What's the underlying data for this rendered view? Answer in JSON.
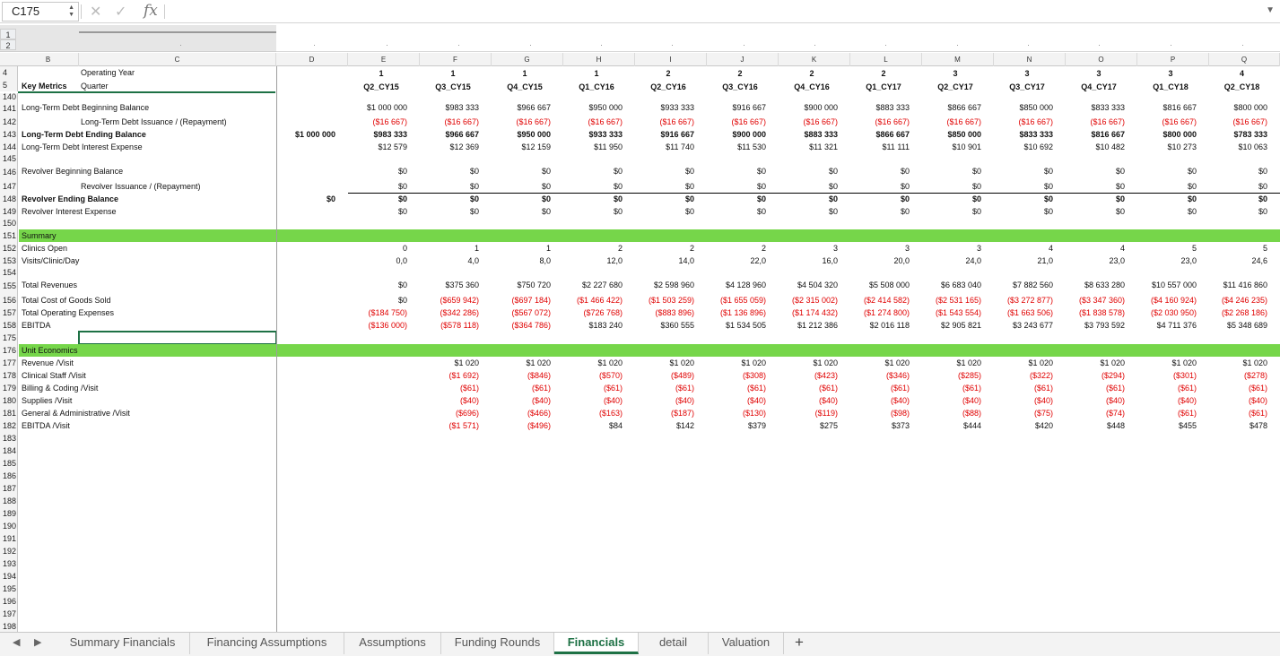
{
  "formula_bar": {
    "cell_ref": "C175",
    "formula": "",
    "cancel_icon": "✕",
    "confirm_icon": "✓",
    "fx_label": "fx"
  },
  "outline": {
    "levels": [
      "1",
      "2"
    ]
  },
  "columns": [
    "B",
    "C",
    "D",
    "E",
    "F",
    "G",
    "H",
    "I",
    "J",
    "K",
    "L",
    "M",
    "N",
    "O",
    "P",
    "Q"
  ],
  "header_rows": {
    "r4": {
      "num": "4",
      "label": "Operating Year",
      "values": [
        "1",
        "1",
        "1",
        "1",
        "2",
        "2",
        "2",
        "2",
        "3",
        "3",
        "3",
        "3",
        "4"
      ]
    },
    "r5": {
      "num": "5",
      "label_b": "Key Metrics",
      "label_c": "Quarter",
      "values": [
        "Q2_CY15",
        "Q3_CY15",
        "Q4_CY15",
        "Q1_CY16",
        "Q2_CY16",
        "Q3_CY16",
        "Q4_CY16",
        "Q1_CY17",
        "Q2_CY17",
        "Q3_CY17",
        "Q4_CY17",
        "Q1_CY18",
        "Q2_CY18"
      ]
    }
  },
  "rows": [
    {
      "num": "140"
    },
    {
      "num": "141",
      "label": "Long-Term Debt Beginning Balance",
      "d": "",
      "values": [
        "$1 000 000",
        "$983 333",
        "$966 667",
        "$950 000",
        "$933 333",
        "$916 667",
        "$900 000",
        "$883 333",
        "$866 667",
        "$850 000",
        "$833 333",
        "$816 667",
        "$800 000"
      ]
    },
    {
      "num": "142",
      "label": "Long-Term Debt Issuance / (Repayment)",
      "indent": true,
      "neg": true,
      "values": [
        "($16 667)",
        "($16 667)",
        "($16 667)",
        "($16 667)",
        "($16 667)",
        "($16 667)",
        "($16 667)",
        "($16 667)",
        "($16 667)",
        "($16 667)",
        "($16 667)",
        "($16 667)",
        "($16 667)"
      ]
    },
    {
      "num": "143",
      "label": "Long-Term Debt Ending Balance",
      "bold": true,
      "d": "$1 000 000",
      "values": [
        "$983 333",
        "$966 667",
        "$950 000",
        "$933 333",
        "$916 667",
        "$900 000",
        "$883 333",
        "$866 667",
        "$850 000",
        "$833 333",
        "$816 667",
        "$800 000",
        "$783 333"
      ]
    },
    {
      "num": "144",
      "label": "Long-Term Debt Interest Expense",
      "values": [
        "$12 579",
        "$12 369",
        "$12 159",
        "$11 950",
        "$11 740",
        "$11 530",
        "$11 321",
        "$11 111",
        "$10 901",
        "$10 692",
        "$10 482",
        "$10 273",
        "$10 063"
      ]
    },
    {
      "num": "145"
    },
    {
      "num": "146",
      "label": "Revolver Beginning Balance",
      "values": [
        "$0",
        "$0",
        "$0",
        "$0",
        "$0",
        "$0",
        "$0",
        "$0",
        "$0",
        "$0",
        "$0",
        "$0",
        "$0"
      ]
    },
    {
      "num": "147",
      "label": "Revolver Issuance / (Repayment)",
      "indent": true,
      "values": [
        "$0",
        "$0",
        "$0",
        "$0",
        "$0",
        "$0",
        "$0",
        "$0",
        "$0",
        "$0",
        "$0",
        "$0",
        "$0"
      ]
    },
    {
      "num": "148",
      "label": "Revolver Ending Balance",
      "bold": true,
      "d": "$0",
      "values": [
        "$0",
        "$0",
        "$0",
        "$0",
        "$0",
        "$0",
        "$0",
        "$0",
        "$0",
        "$0",
        "$0",
        "$0",
        "$0"
      ]
    },
    {
      "num": "149",
      "label": "Revolver Interest Expense",
      "values": [
        "$0",
        "$0",
        "$0",
        "$0",
        "$0",
        "$0",
        "$0",
        "$0",
        "$0",
        "$0",
        "$0",
        "$0",
        "$0"
      ]
    },
    {
      "num": "150"
    },
    {
      "num": "151",
      "label": "Summary",
      "green": true
    },
    {
      "num": "152",
      "label": "Clinics Open",
      "values": [
        "0",
        "1",
        "1",
        "2",
        "2",
        "2",
        "3",
        "3",
        "3",
        "4",
        "4",
        "5",
        "5"
      ]
    },
    {
      "num": "153",
      "label": "Visits/Clinic/Day",
      "values": [
        "0,0",
        "4,0",
        "8,0",
        "12,0",
        "14,0",
        "22,0",
        "16,0",
        "20,0",
        "24,0",
        "21,0",
        "23,0",
        "23,0",
        "24,6"
      ]
    },
    {
      "num": "154"
    },
    {
      "num": "155",
      "label": "Total Revenues",
      "values": [
        "$0",
        "$375 360",
        "$750 720",
        "$2 227 680",
        "$2 598 960",
        "$4 128 960",
        "$4 504 320",
        "$5 508 000",
        "$6 683 040",
        "$7 882 560",
        "$8 633 280",
        "$10 557 000",
        "$11 416 860"
      ]
    },
    {
      "num": "156",
      "label": "Total Cost of Goods Sold",
      "neg_from": 1,
      "values": [
        "$0",
        "($659 942)",
        "($697 184)",
        "($1 466 422)",
        "($1 503 259)",
        "($1 655 059)",
        "($2 315 002)",
        "($2 414 582)",
        "($2 531 165)",
        "($3 272 877)",
        "($3 347 360)",
        "($4 160 924)",
        "($4 246 235)"
      ]
    },
    {
      "num": "157",
      "label": "Total Operating Expenses",
      "neg": true,
      "values": [
        "($184 750)",
        "($342 286)",
        "($567 072)",
        "($726 768)",
        "($883 896)",
        "($1 136 896)",
        "($1 174 432)",
        "($1 274 800)",
        "($1 543 554)",
        "($1 663 506)",
        "($1 838 578)",
        "($2 030 950)",
        "($2 268 186)"
      ]
    },
    {
      "num": "158",
      "label": "EBITDA",
      "values": [
        "($136 000)",
        "($578 118)",
        "($364 786)",
        "$183 240",
        "$360 555",
        "$1 534 505",
        "$1 212 386",
        "$2 016 118",
        "$2 905 821",
        "$3 243 677",
        "$3 793 592",
        "$4 711 376",
        "$5 348 689"
      ]
    },
    {
      "num": "175",
      "selected": true
    },
    {
      "num": "176",
      "label": "Unit Economics",
      "green": true
    },
    {
      "num": "177",
      "label": "Revenue /Visit",
      "values": [
        "",
        "$1 020",
        "$1 020",
        "$1 020",
        "$1 020",
        "$1 020",
        "$1 020",
        "$1 020",
        "$1 020",
        "$1 020",
        "$1 020",
        "$1 020",
        "$1 020"
      ]
    },
    {
      "num": "178",
      "label": "Clinical Staff /Visit",
      "neg": true,
      "values": [
        "",
        "($1 692)",
        "($846)",
        "($570)",
        "($489)",
        "($308)",
        "($423)",
        "($346)",
        "($285)",
        "($322)",
        "($294)",
        "($301)",
        "($278)"
      ]
    },
    {
      "num": "179",
      "label": "Billing & Coding /Visit",
      "neg": true,
      "values": [
        "",
        "($61)",
        "($61)",
        "($61)",
        "($61)",
        "($61)",
        "($61)",
        "($61)",
        "($61)",
        "($61)",
        "($61)",
        "($61)",
        "($61)"
      ]
    },
    {
      "num": "180",
      "label": "Supplies /Visit",
      "neg": true,
      "values": [
        "",
        "($40)",
        "($40)",
        "($40)",
        "($40)",
        "($40)",
        "($40)",
        "($40)",
        "($40)",
        "($40)",
        "($40)",
        "($40)",
        "($40)"
      ]
    },
    {
      "num": "181",
      "label": "General & Administrative /Visit",
      "neg": true,
      "values": [
        "",
        "($696)",
        "($466)",
        "($163)",
        "($187)",
        "($130)",
        "($119)",
        "($98)",
        "($88)",
        "($75)",
        "($74)",
        "($61)",
        "($61)"
      ]
    },
    {
      "num": "182",
      "label": "EBITDA /Visit",
      "values": [
        "",
        "($1 571)",
        "($496)",
        "$84",
        "$142",
        "$379",
        "$275",
        "$373",
        "$444",
        "$420",
        "$448",
        "$455",
        "$478"
      ]
    },
    {
      "num": "183"
    },
    {
      "num": "184"
    },
    {
      "num": "185"
    },
    {
      "num": "186"
    },
    {
      "num": "187"
    },
    {
      "num": "188"
    },
    {
      "num": "189"
    },
    {
      "num": "190"
    },
    {
      "num": "191"
    },
    {
      "num": "192"
    },
    {
      "num": "193"
    },
    {
      "num": "194"
    },
    {
      "num": "195"
    },
    {
      "num": "196"
    },
    {
      "num": "197"
    },
    {
      "num": "198"
    }
  ],
  "sheet_tabs": [
    "Summary Financials",
    "Financing Assumptions",
    "Assumptions",
    "Funding Rounds",
    "Financials",
    "detail",
    "Valuation"
  ],
  "active_tab": "Financials",
  "add_tab_icon": "+",
  "colors": {
    "accent": "#1e7145",
    "negative": "#e00000",
    "section_fill": "#76d64a"
  }
}
